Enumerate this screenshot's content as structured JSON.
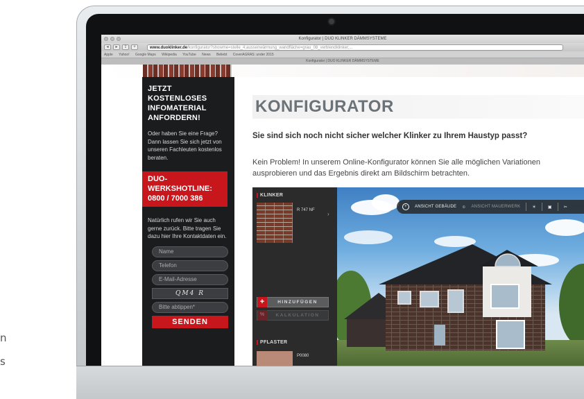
{
  "stray_text": [
    "n",
    "s"
  ],
  "browser": {
    "window_title": "Konfigurator | DUO KLINKER DÄMMSYSTEME",
    "url_domain": "www.duoklinker.de",
    "url_rest": "/konfigurator?showme=stelle_4;aussenwärmung_wandfläche=grau_08_verblendklinker;...",
    "bookmarks": [
      "Apple",
      "Yahoo!",
      "Google Maps",
      "Wikipedia",
      "YouTube",
      "News",
      "Beliebt",
      "CoverAGRAS: under 2015"
    ],
    "tab_title": "Konfigurator | DUO KLINKER DÄMMSYSTEME"
  },
  "sidebar": {
    "title": "JETZT KOSTENLOSES INFOMATERIAL ANFORDERN!",
    "text": "Oder haben Sie eine Frage? Dann lassen Sie sich jetzt von unseren Fachleuten kostenlos beraten.",
    "hotline": "DUO-WERKSHOTLINE: 0800 / 7000 386",
    "contact_text": "Natürlich rufen wir Sie auch gerne zurück. Bitte tragen Sie dazu hier Ihre Kontaktdaten ein.",
    "fields": {
      "name": "Name",
      "phone": "Telefon",
      "email": "E-Mail-Adresse",
      "captcha": "QM4 R",
      "captcha_input": "Bitte abtippen*"
    },
    "send_label": "SENDEN"
  },
  "main": {
    "heading": "KONFIGURATOR",
    "subheading": "Sie sind sich noch nicht sicher welcher Klinker zu Ihrem Haustyp passt?",
    "intro": "Kein Problem! In unserem Online-Konfigurator können Sie alle möglichen Variationen ausprobieren und das Ergebnis direkt am Bildschirm betrachten."
  },
  "configurator": {
    "klinker_label": "KLINKER",
    "klinker_code": "R 747 NF",
    "add_label": "HINZUFÜGEN",
    "calc_label": "KALKULATION",
    "pflaster_label": "PFLASTER",
    "pflaster_code": "P0080",
    "view_building": "ANSICHT GEBÄUDE",
    "view_masonry": "ANSICHT MAUERWERK"
  },
  "colors": {
    "brand_red": "#c8161d",
    "sidebar_bg": "#1b1c1e",
    "heading_grey": "#6b7378"
  }
}
